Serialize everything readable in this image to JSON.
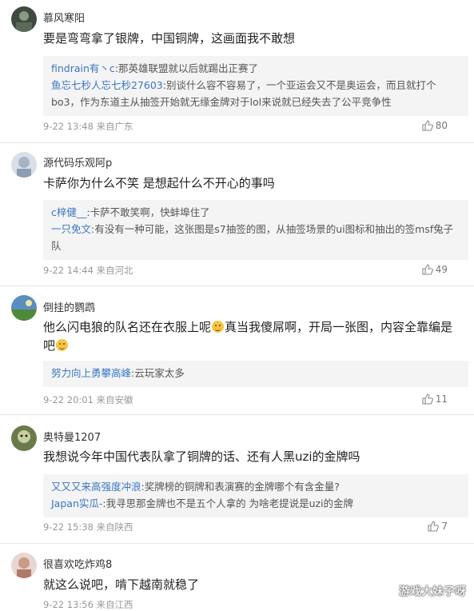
{
  "comments": [
    {
      "username": "慕风寒阳",
      "content": "要是弯弯拿了银牌，中国铜牌，这画面我不敢想",
      "replies": [
        {
          "name": "findrain有丶c",
          "sep": ":",
          "text": "那英雄联盟就以后就踢出正赛了"
        },
        {
          "name": "鱼忘七秒人忘七秒27603",
          "sep": ":",
          "text": "别谈什么容不容易了，一个亚运会又不是奥运会，而且就打个bo3，作为东道主从抽签开始就无缘金牌对于lol来说就已经失去了公平竞争性"
        }
      ],
      "meta": "9-22 13:48 来自广东",
      "likes": "80"
    },
    {
      "username": "源代码乐观阿p",
      "content": "卡萨你为什么不笑 是想起什么不开心的事吗",
      "replies": [
        {
          "name": "c梓健__",
          "sep": ":",
          "text": "卡萨不敢笑啊，快蚌埠住了"
        },
        {
          "name": "一只免文",
          "sep": ":",
          "text": "有没有一种可能，这张图是s7抽签的图，从抽签场景的ui图标和抽出的签msf兔子队"
        }
      ],
      "meta": "9-22 14:44 来自河北",
      "likes": "49"
    },
    {
      "username": "倒挂的鹦鹉",
      "content_a": "他么闪电狼的队名还在衣服上呢",
      "content_b": "真当我傻屌啊，开局一张图，内容全靠编是吧",
      "replies": [
        {
          "name": "努力向上勇攀高峰",
          "sep": ":",
          "text": "云玩家太多"
        }
      ],
      "meta": "9-22 20:01 来自安徽",
      "likes": "11"
    },
    {
      "username": "奥特曼1207",
      "content": "我想说今年中国代表队拿了铜牌的话、还有人黑uzi的金牌吗",
      "replies": [
        {
          "name": "又又又来高强度冲浪",
          "sep": ":",
          "text": "奖牌榜的铜牌和表演赛的金牌哪个有含金量?"
        },
        {
          "name": "Japan实瓜-",
          "sep": ":",
          "text": "我寻思那金牌也不是五个人拿的 为啥老提说是uzi的金牌"
        }
      ],
      "meta": "9-22 15:38 来自陕西",
      "likes": "7"
    },
    {
      "username": "很喜欢吃炸鸡8",
      "content": "就这么说吧，啃下越南就稳了",
      "meta": "9-22 13:56 来自江西"
    }
  ],
  "watermark": "游戏大妹子呀",
  "colors": {
    "reply_name": "#3a76c2",
    "reply_bg": "#f4f4f4",
    "meta": "#999999"
  },
  "icons": {
    "like": "thumbs-up-icon"
  }
}
